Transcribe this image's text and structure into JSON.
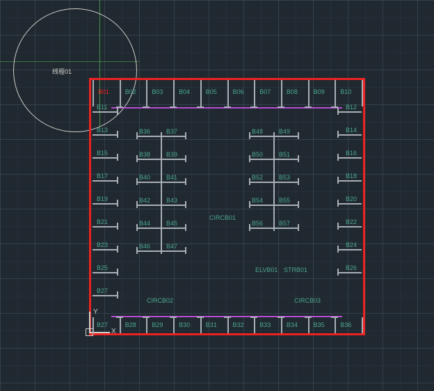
{
  "ucs": {
    "x_label": "X",
    "y_label": "Y"
  },
  "annotations": {
    "thread": "线程01"
  },
  "labels": {
    "top": [
      "B01",
      "B02",
      "B03",
      "B04",
      "B05",
      "B06",
      "B07",
      "B08",
      "B09",
      "B10"
    ],
    "left": [
      "B11",
      "B13",
      "B15",
      "B17",
      "B19",
      "B21",
      "B23",
      "B25",
      "B27"
    ],
    "right": [
      "B12",
      "B14",
      "B16",
      "B18",
      "B20",
      "B22",
      "B24",
      "B26"
    ],
    "bottom": [
      "B28",
      "B29",
      "B30",
      "B31",
      "B32",
      "B33",
      "B34",
      "B35",
      "B36"
    ],
    "g1_rows": [
      [
        "B36",
        "B37"
      ],
      [
        "B38",
        "B39"
      ],
      [
        "B40",
        "B41"
      ],
      [
        "B42",
        "B43"
      ],
      [
        "B44",
        "B45"
      ],
      [
        "B46",
        "B47"
      ]
    ],
    "g2_rows": [
      [
        "B48",
        "B49"
      ],
      [
        "B50",
        "B51"
      ],
      [
        "B52",
        "B53"
      ],
      [
        "B54",
        "B55"
      ],
      [
        "B56",
        "B57"
      ]
    ],
    "circb01": "CIRCB01",
    "circb02": "CIRCB02",
    "circb03": "CIRCB03",
    "elvb01": "ELVB01",
    "strb01": "STRB01"
  },
  "colors": {
    "frame": "#e22",
    "wall": "#a9b0b6",
    "purple": "#b84cd4",
    "text": "#4ca98e"
  }
}
